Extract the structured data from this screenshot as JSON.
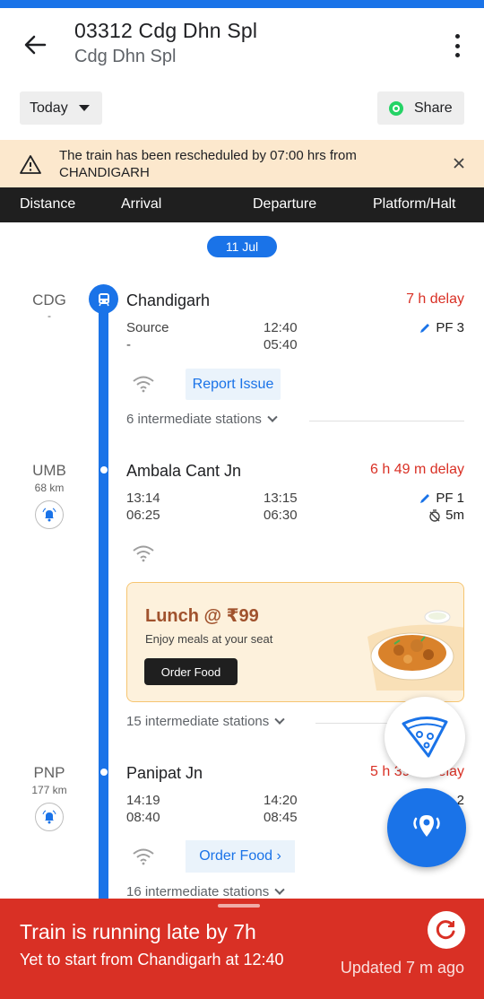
{
  "header": {
    "title": "03312 Cdg Dhn Spl",
    "subtitle": "Cdg Dhn Spl"
  },
  "controls": {
    "date_selector": "Today",
    "share_label": "Share"
  },
  "alert": {
    "text": "The train has been rescheduled by 07:00 hrs from CHANDIGARH"
  },
  "columns": [
    "Distance",
    "Arrival",
    "Departure",
    "Platform/Halt"
  ],
  "date_pill": "11 Jul",
  "stations": [
    {
      "code": "CDG",
      "km": "-",
      "name": "Chandigarh",
      "delay": "7 h delay",
      "sched_arr": "Source",
      "actual_arr": "-",
      "sched_dep": "12:40",
      "actual_dep": "05:40",
      "platform": "PF 3",
      "halt": "",
      "action": "Report Issue",
      "intermediate": "6 intermediate stations"
    },
    {
      "code": "UMB",
      "km": "68 km",
      "name": "Ambala Cant Jn",
      "delay": "6 h 49 m delay",
      "sched_arr": "13:14",
      "actual_arr": "06:25",
      "sched_dep": "13:15",
      "actual_dep": "06:30",
      "platform": "PF 1",
      "halt": "5m",
      "action": "",
      "intermediate": "15 intermediate stations"
    },
    {
      "code": "PNP",
      "km": "177 km",
      "name": "Panipat Jn",
      "delay": "5 h 39 m delay",
      "sched_arr": "14:19",
      "actual_arr": "08:40",
      "sched_dep": "14:20",
      "actual_dep": "08:45",
      "platform": "2",
      "halt": "",
      "action": "Order Food ›",
      "intermediate": "16 intermediate stations"
    }
  ],
  "promo": {
    "title": "Lunch @ ₹99",
    "subtitle": "Enjoy meals at your seat",
    "button": "Order Food"
  },
  "status": {
    "title": "Train is running late by 7h",
    "subtitle": "Yet to start from Chandigarh at 12:40",
    "updated": "Updated 7 m  ago"
  },
  "colors": {
    "accent": "#1a73e8",
    "delay_red": "#d93025",
    "alert_bg": "#fce8cd"
  }
}
